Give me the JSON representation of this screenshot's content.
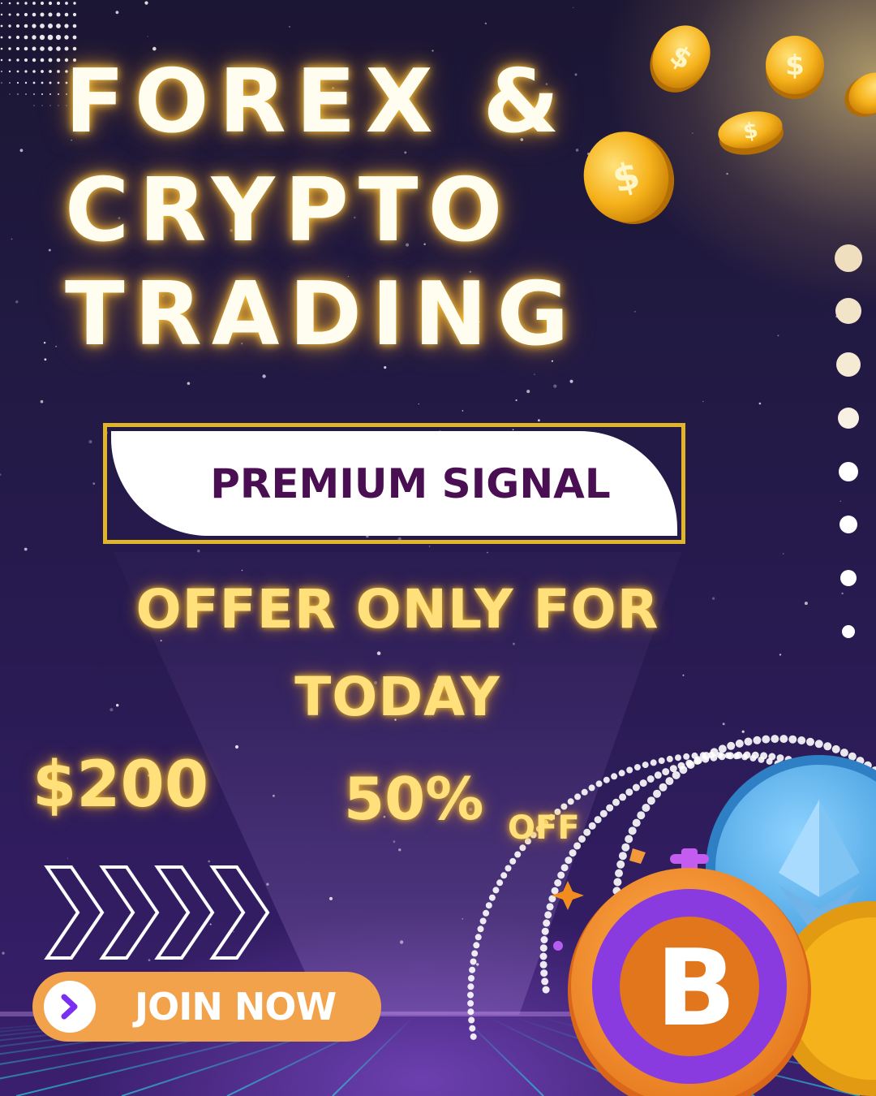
{
  "headline": {
    "line1": "FOREX &",
    "line2": "CRYPTO",
    "line3": "TRADING"
  },
  "badge": {
    "label": "PREMIUM SIGNAL"
  },
  "offer": {
    "line1": "OFFER ONLY FOR",
    "line2": "TODAY"
  },
  "pricing": {
    "price": "$200",
    "discount": "50%",
    "discount_suffix": "OFF"
  },
  "cta": {
    "label": "JOIN NOW",
    "icon": "chevron-right-icon"
  },
  "icons": {
    "coin_symbol": "$",
    "bitcoin_symbol": "B"
  },
  "colors": {
    "headline": "#fffdf0",
    "glow": "#ffc83c",
    "gold_text": "#ffe07a",
    "badge_border": "#e0b52a",
    "badge_text": "#4a0e52",
    "button": "#f2a24a",
    "chevron": "#7b2ff0",
    "coin_gold": "#f6b21b",
    "bitcoin_orange": "#f28c1e",
    "bitcoin_purple": "#8a3be0",
    "eth_blue": "#57b6f0"
  }
}
